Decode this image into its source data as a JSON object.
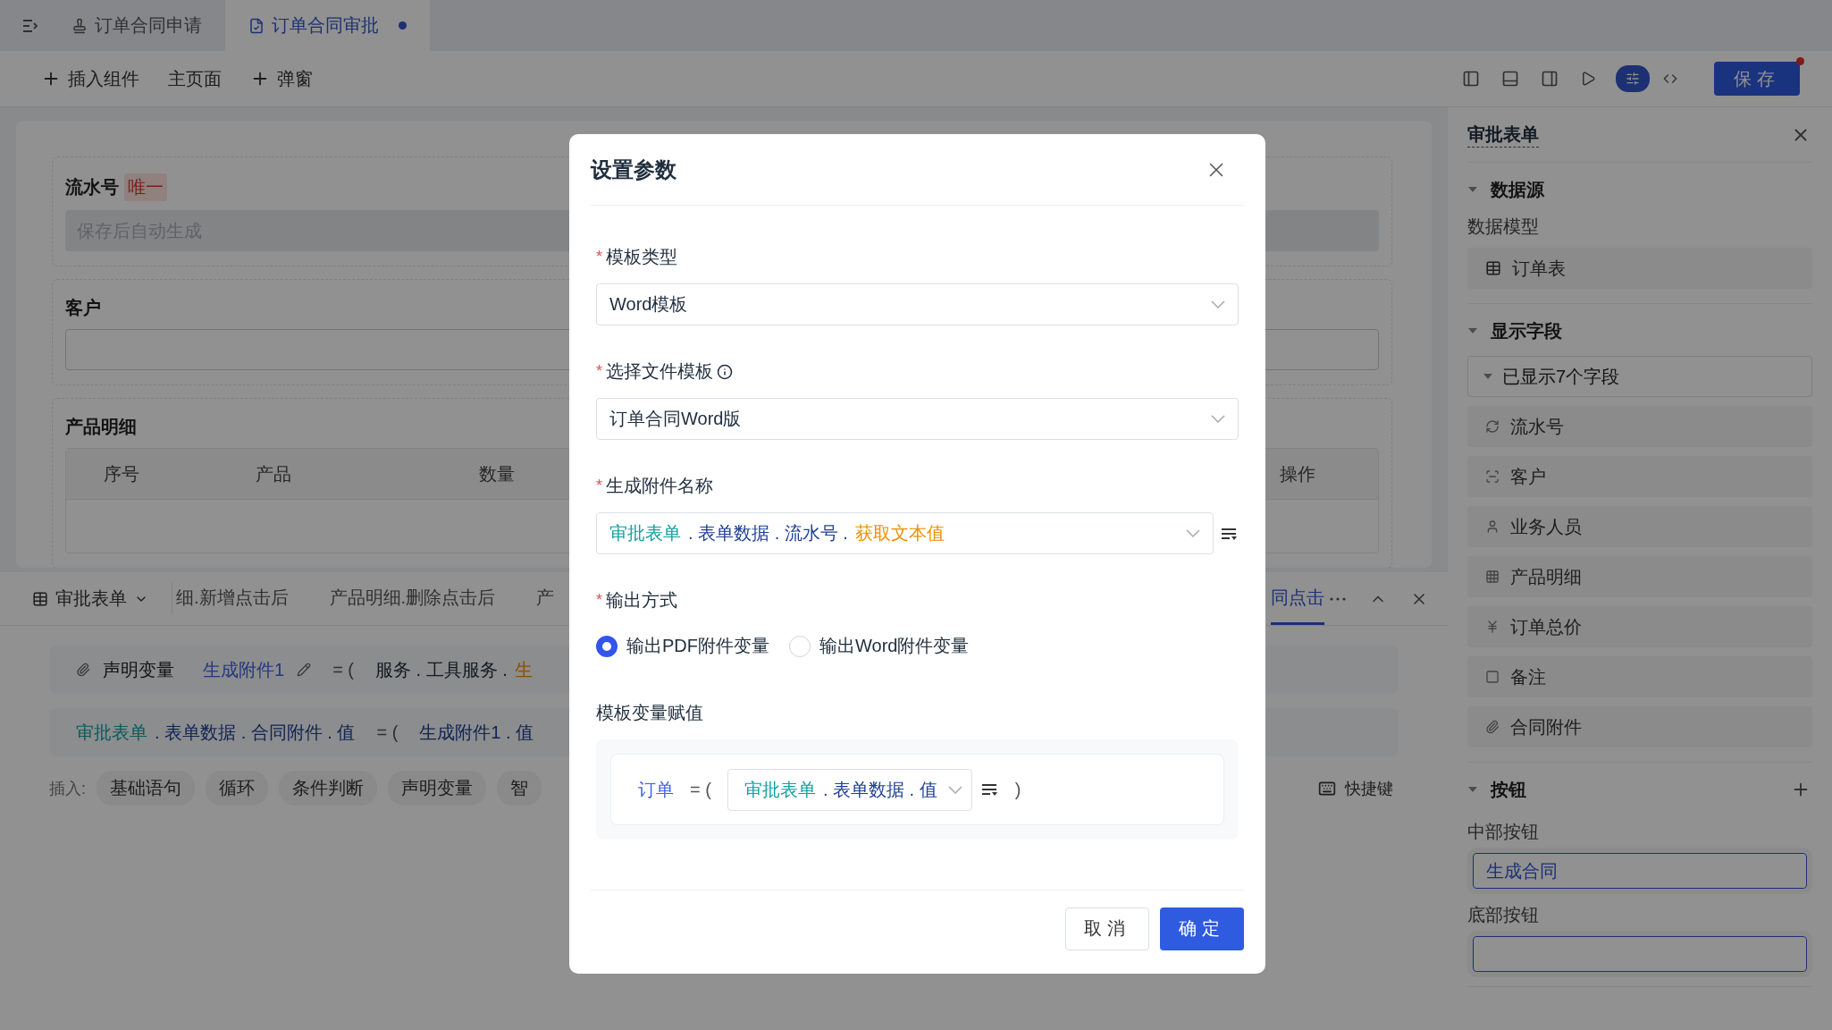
{
  "tabs": [
    {
      "label": "订单合同申请",
      "selected": false,
      "modified": false
    },
    {
      "label": "订单合同审批",
      "selected": true,
      "modified": true
    }
  ],
  "toolbar": {
    "actions": [
      {
        "label": "插入组件",
        "kind": "add"
      },
      {
        "label": "主页面",
        "kind": "plain"
      },
      {
        "label": "弹窗",
        "kind": "add"
      }
    ],
    "mode_toggle": [
      {
        "kind": "settings",
        "selected": true
      },
      {
        "kind": "code",
        "selected": false
      }
    ],
    "save": {
      "label": "保存",
      "unsaved": true
    }
  },
  "form": {
    "fields": [
      {
        "kind": "input",
        "label": "流水号",
        "tag": "唯一",
        "placeholder": "保存后自动生成",
        "disabled": true
      },
      {
        "kind": "input",
        "label": "客户",
        "disabled": false
      },
      {
        "kind": "table",
        "label": "产品明细",
        "columns": [
          "序号",
          "产品",
          "数量",
          "操作"
        ]
      }
    ]
  },
  "event_panel": {
    "component": "审批表单",
    "tabs": [
      {
        "label": "细.新增点击后",
        "selected": false
      },
      {
        "label": "产品明细.删除点击后",
        "selected": false
      },
      {
        "label": "产",
        "selected": false
      },
      {
        "label": "同点击",
        "selected": true
      }
    ],
    "statements": [
      {
        "kind": "declare",
        "keyword": "声明变量",
        "name": "生成附件1",
        "operator": "= (",
        "value": [
          {
            "text": "服务 . 工具服务 .",
            "kind": "plain"
          },
          {
            "text": "生",
            "kind": "func"
          }
        ]
      },
      {
        "kind": "assign",
        "target": [
          {
            "text": "审批表单",
            "kind": "source"
          },
          {
            "text": ". 表单数据 . 合同附件 . 值",
            "kind": "path"
          }
        ],
        "operator": "= (",
        "value": [
          {
            "text": "生成附件1 . 值",
            "kind": "path"
          }
        ]
      }
    ],
    "insert": {
      "label": "插入:",
      "chips": [
        "基础语句",
        "循环",
        "条件判断",
        "声明变量",
        "智"
      ]
    },
    "shortcut": "快捷键"
  },
  "side_panel": {
    "title": "审批表单",
    "sections": [
      {
        "kind": "data_source",
        "title": "数据源",
        "expanded": true,
        "label": "数据模型",
        "model": "订单表"
      },
      {
        "kind": "fields",
        "title": "显示字段",
        "expanded": true,
        "summary": "已显示7个字段",
        "summary_expanded": true,
        "items": [
          {
            "label": "流水号",
            "kind": "serial"
          },
          {
            "label": "客户",
            "kind": "contact"
          },
          {
            "label": "业务人员",
            "kind": "user"
          },
          {
            "label": "产品明细",
            "kind": "table"
          },
          {
            "label": "订单总价",
            "kind": "money"
          },
          {
            "label": "备注",
            "kind": "text"
          },
          {
            "label": "合同附件",
            "kind": "attachment"
          }
        ]
      },
      {
        "kind": "buttons",
        "title": "按钮",
        "expanded": true,
        "groups": [
          {
            "label": "中部按钮",
            "button": "生成合同"
          },
          {
            "label": "底部按钮"
          }
        ]
      }
    ]
  },
  "dialog": {
    "title": "设置参数",
    "fields": [
      {
        "kind": "select",
        "required": true,
        "mark": "*",
        "label": "模板类型",
        "info": false,
        "value": [
          {
            "text": "Word模板",
            "kind": "plain"
          }
        ]
      },
      {
        "kind": "select",
        "required": true,
        "mark": "*",
        "label": "选择文件模板",
        "info": true,
        "value": [
          {
            "text": "订单合同Word版",
            "kind": "plain"
          }
        ]
      },
      {
        "kind": "expression",
        "required": true,
        "mark": "*",
        "label": "生成附件名称",
        "info": false,
        "value": [
          {
            "text": "审批表单",
            "kind": "source"
          },
          {
            "text": ". 表单数据 . 流水号 .",
            "kind": "path"
          },
          {
            "text": "获取文本值",
            "kind": "func"
          }
        ]
      },
      {
        "kind": "radio",
        "required": true,
        "mark": "*",
        "label": "输出方式",
        "info": false,
        "options": [
          {
            "label": "输出PDF附件变量",
            "selected": true
          },
          {
            "label": "输出Word附件变量",
            "selected": false
          }
        ]
      },
      {
        "kind": "assignments",
        "required": false,
        "label": "模板变量赋值",
        "info": false,
        "rows": [
          {
            "name": "订单",
            "operator": "= (",
            "value": [
              {
                "text": "审批表单",
                "kind": "source"
              },
              {
                "text": ". 表单数据 . 值",
                "kind": "path"
              }
            ],
            "close": ")"
          }
        ]
      }
    ],
    "buttons": [
      {
        "label": "取消",
        "kind": "secondary"
      },
      {
        "label": "确定",
        "kind": "primary"
      }
    ]
  }
}
